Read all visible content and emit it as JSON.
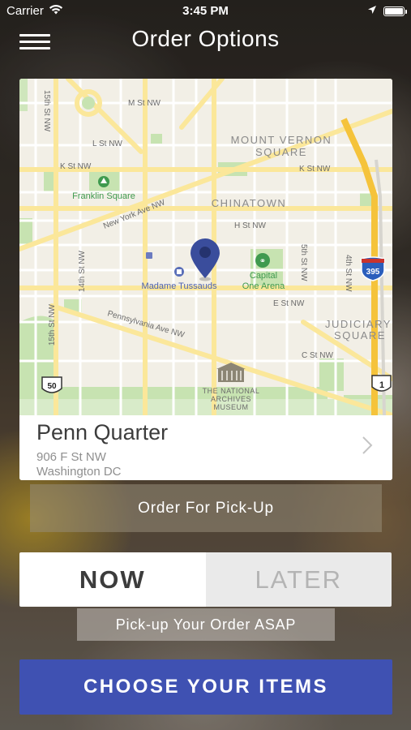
{
  "status_bar": {
    "carrier": "Carrier",
    "time": "3:45 PM",
    "battery_level": 1.0
  },
  "nav": {
    "title": "Order Options",
    "menu_icon": "hamburger-menu-icon"
  },
  "map": {
    "neighborhoods": [
      "MOUNT VERNON",
      "SQUARE",
      "CHINATOWN",
      "JUDICIARY",
      "SQUARE"
    ],
    "streets": {
      "m_st": "M St NW",
      "l_st": "L St NW",
      "k_st_left": "K St NW",
      "k_st_right": "K St NW",
      "h_st": "H St NW",
      "e_st": "E St NW",
      "c_st": "C St NW",
      "ny_ave": "New York Ave NW",
      "penn_ave": "Pennsylvania Ave NW",
      "st15_top": "15th St NW",
      "st14": "14th St NW",
      "st15_bottom": "15th St NW",
      "st5": "5th St NW",
      "st4": "4th St NW"
    },
    "pois": {
      "franklin_square": "Franklin Square",
      "madame_tussauds": "Madame Tussauds",
      "capital_one_1": "Capital",
      "capital_one_2": "One Arena",
      "archives_1": "THE NATIONAL",
      "archives_2": "ARCHIVES",
      "archives_3": "MUSEUM"
    },
    "shields": {
      "i395": "395",
      "us50": "50",
      "us1": "1"
    },
    "pin_icon": "map-pin-icon"
  },
  "location": {
    "name": "Penn Quarter",
    "address_line1": "906 F St NW",
    "address_line2": "Washington DC",
    "chevron_icon": "chevron-right-icon"
  },
  "pickup": {
    "label": "Order For Pick-Up"
  },
  "timing": {
    "now_label": "NOW",
    "later_label": "LATER",
    "selected": "NOW",
    "note": "Pick-up Your Order ASAP"
  },
  "cta": {
    "label": "CHOOSE YOUR ITEMS"
  },
  "colors": {
    "brand_blue": "#3f51b2",
    "pin_blue": "#3a4d9c",
    "park_green": "#c7e3b1",
    "map_road_yellow": "#fbe79a"
  }
}
